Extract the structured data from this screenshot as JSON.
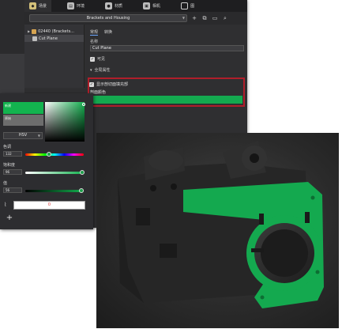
{
  "toolbar": {
    "tabs": [
      {
        "label": "场景",
        "icon": "scene-icon",
        "active": true
      },
      {
        "label": "环境",
        "icon": "environment-icon",
        "active": false
      },
      {
        "label": "材质",
        "icon": "material-icon",
        "active": false
      },
      {
        "label": "相机",
        "icon": "camera-icon",
        "active": false
      },
      {
        "label": "图",
        "icon": "filmstrip-icon",
        "active": false
      }
    ]
  },
  "document": {
    "selector_value": "Brackets and Housing",
    "tool_icons": [
      "plus-icon",
      "duplicate-icon",
      "save-icon",
      "search-icon"
    ]
  },
  "tree": {
    "items": [
      {
        "label": "02440 (Brackets...",
        "icon": "assembly-icon",
        "selected": false
      },
      {
        "label": "Cut Plane",
        "icon": "cut-plane-icon",
        "selected": true
      }
    ]
  },
  "properties": {
    "tabs": [
      "常规",
      "转换"
    ],
    "name_label": "名称",
    "name_value": "Cut Plane",
    "visible_label": "可见",
    "section_label": "全局属性",
    "show_cap_label": "显示剖切面填充部",
    "cap_color_label": "剖面颜色",
    "cap_color": "#14a94f"
  },
  "picker": {
    "new_label": "新建",
    "old_label": "原始",
    "mode": "HSV",
    "hue_label": "色调",
    "hue_value": "132",
    "saturation_label": "饱和度",
    "saturation_value": "96",
    "value_label": "值",
    "value_value": "56",
    "hex_value": "0",
    "colors": {
      "new": "#13b34f",
      "old": "#6d6d6d",
      "accent": "#14a94f",
      "highlight": "#b01e2a"
    }
  }
}
